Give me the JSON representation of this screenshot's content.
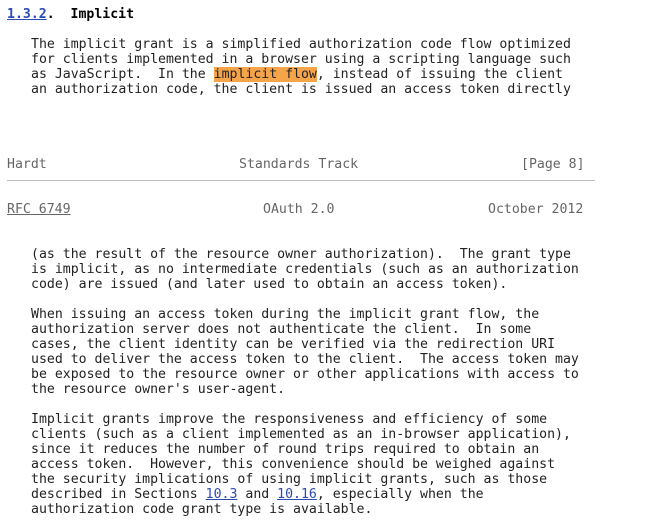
{
  "section": {
    "number": "1.3.2",
    "title": "Implicit",
    "para1": {
      "line1": "The implicit grant is a simplified authorization code flow optimized",
      "line2": "for clients implemented in a browser using a scripting language such",
      "line3_pre": "as JavaScript.  In the ",
      "line3_highlight": "implicit flow",
      "line3_post": ", instead of issuing the client",
      "line4": "an authorization code, the client is issued an access token directly"
    }
  },
  "footer": {
    "author": "Hardt",
    "track": "Standards Track",
    "page": "[Page 8]"
  },
  "header": {
    "rfc": "RFC 6749",
    "title": "OAuth 2.0",
    "date": "October 2012"
  },
  "body": {
    "para2": [
      "(as the result of the resource owner authorization).  The grant type",
      "is implicit, as no intermediate credentials (such as an authorization",
      "code) are issued (and later used to obtain an access token)."
    ],
    "para3": [
      "When issuing an access token during the implicit grant flow, the",
      "authorization server does not authenticate the client.  In some",
      "cases, the client identity can be verified via the redirection URI",
      "used to deliver the access token to the client.  The access token may",
      "be exposed to the resource owner or other applications with access to",
      "the resource owner's user-agent."
    ],
    "para4": [
      "Implicit grants improve the responsiveness and efficiency of some",
      "clients (such as a client implemented as an in-browser application),",
      "since it reduces the number of round trips required to obtain an",
      "access token.  However, this convenience should be weighed against",
      "the security implications of using implicit grants, such as those"
    ],
    "para4_line6": {
      "pre": "described in Sections ",
      "link1": "10.3",
      "mid": " and ",
      "link2": "10.16",
      "post": ", especially when the"
    },
    "para4_line7": "authorization code grant type is available."
  }
}
